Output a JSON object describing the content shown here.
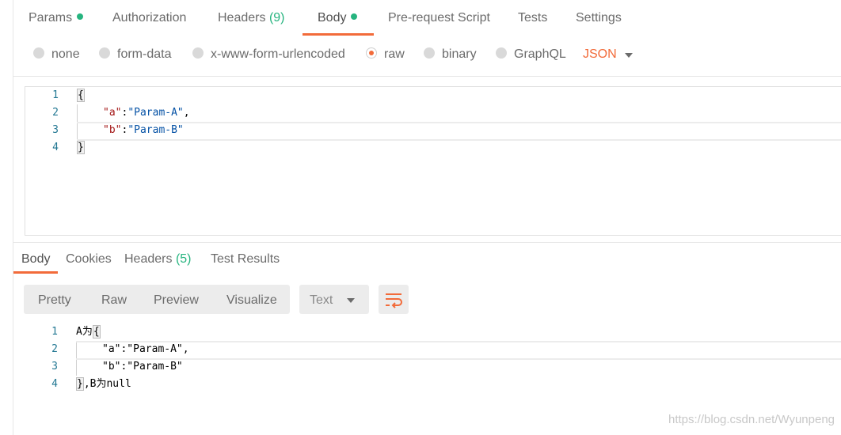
{
  "request_tabs": {
    "params": "Params",
    "authorization": "Authorization",
    "headers": "Headers",
    "headers_count": "(9)",
    "body": "Body",
    "pre_request": "Pre-request Script",
    "tests": "Tests",
    "settings": "Settings"
  },
  "body_types": {
    "none": "none",
    "form_data": "form-data",
    "urlencoded": "x-www-form-urlencoded",
    "raw": "raw",
    "binary": "binary",
    "graphql": "GraphQL",
    "selected_format": "JSON"
  },
  "request_editor": {
    "line_numbers": [
      "1",
      "2",
      "3",
      "4"
    ],
    "line1": "{",
    "line2_key": "\"a\"",
    "line2_colon": ":",
    "line2_value": "\"Param-A\"",
    "line2_comma": ",",
    "line3_key": "\"b\"",
    "line3_colon": ":",
    "line3_value": "\"Param-B\"",
    "line4": "}"
  },
  "response_tabs": {
    "body": "Body",
    "cookies": "Cookies",
    "headers": "Headers",
    "headers_count": "(5)",
    "test_results": "Test Results"
  },
  "view_modes": {
    "pretty": "Pretty",
    "raw": "Raw",
    "preview": "Preview",
    "visualize": "Visualize",
    "type": "Text"
  },
  "response_editor": {
    "line_numbers": [
      "1",
      "2",
      "3",
      "4"
    ],
    "line1_prefix": "A为",
    "line1_brace": "{",
    "line2": "\"a\":\"Param-A\",",
    "line3": "\"b\":\"Param-B\"",
    "line4_brace": "}",
    "line4_suffix": ",B为null"
  },
  "watermark": "https://blog.csdn.net/Wyunpeng",
  "colors": {
    "accent": "#f26b3a",
    "success": "#26b47f",
    "line_number": "#237893"
  }
}
